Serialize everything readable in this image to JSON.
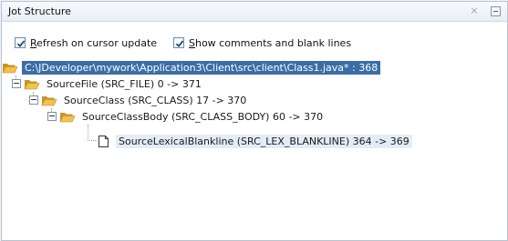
{
  "window": {
    "title": "Jot Structure",
    "close_glyph": "×"
  },
  "options": {
    "refresh_prefix": "",
    "refresh_mnemonic": "R",
    "refresh_rest": "efresh on cursor update",
    "refresh_checked": true,
    "show_mnemonic": "S",
    "show_rest": "how comments and blank lines",
    "show_checked": true
  },
  "tree": {
    "root": "C:\\JDeveloper\\mywork\\Application3\\Client\\src\\client\\Class1.java* : 368",
    "nodes": [
      {
        "label": "SourceFile (SRC_FILE) 0 -> 371"
      },
      {
        "label": "SourceClass (SRC_CLASS) 17 -> 370"
      },
      {
        "label": "SourceClassBody (SRC_CLASS_BODY) 60 -> 370"
      },
      {
        "label": "SourceLexicalBlankline (SRC_LEX_BLANKLINE) 364 -> 369"
      }
    ]
  },
  "colors": {
    "selection": "#3a6ea5",
    "folder": "#e9b843",
    "highlight": "#e4ecf7"
  }
}
